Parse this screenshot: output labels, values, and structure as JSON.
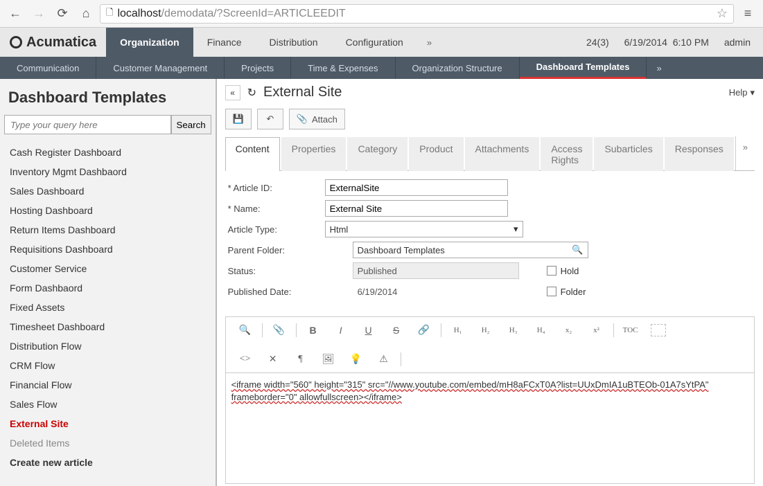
{
  "browser": {
    "url_host": "localhost",
    "url_path": "/demodata/?ScreenId=ARTICLEEDIT"
  },
  "brand": "Acumatica",
  "top_tabs": [
    "Organization",
    "Finance",
    "Distribution",
    "Configuration"
  ],
  "top_right": {
    "count": "24(3)",
    "date": "6/19/2014",
    "time": "6:10 PM",
    "user": "admin"
  },
  "sub_nav": [
    "Communication",
    "Customer Management",
    "Projects",
    "Time & Expenses",
    "Organization Structure",
    "Dashboard Templates"
  ],
  "sidebar": {
    "title": "Dashboard Templates",
    "search_placeholder": "Type your query here",
    "search_btn": "Search",
    "items": [
      "Cash Register Dashboard",
      "Inventory Mgmt Dashbaord",
      "Sales Dashboard",
      "Hosting Dashboard",
      "Return Items Dashboard",
      "Requisitions Dashboard",
      "Customer Service",
      "Form Dashbaord",
      "Fixed Assets",
      "Timesheet Dashboard",
      "Distribution Flow",
      "CRM Flow",
      "Financial Flow",
      "Sales Flow",
      "External Site",
      "Deleted Items",
      "Create new article"
    ]
  },
  "content": {
    "title": "External Site",
    "help": "Help",
    "attach": "Attach",
    "tabs": [
      "Content",
      "Properties",
      "Category",
      "Product",
      "Attachments",
      "Access Rights",
      "Subarticles",
      "Responses"
    ],
    "form": {
      "article_id_label": "Article ID:",
      "article_id": "ExternalSite",
      "name_label": "Name:",
      "name": "External Site",
      "type_label": "Article Type:",
      "type": "Html",
      "parent_label": "Parent Folder:",
      "parent": "Dashboard Templates",
      "status_label": "Status:",
      "status": "Published",
      "hold_label": "Hold",
      "pubdate_label": "Published Date:",
      "pubdate": "6/19/2014",
      "folder_label": "Folder"
    },
    "editor_text": "<iframe width=\"560\" height=\"315\" src=\"//www.youtube.com/embed/mH8aFCxT0A?list=UUxDmIA1uBTEOb-01A7sYtPA\" frameborder=\"0\" allowfullscreen></iframe>",
    "editor_labels": {
      "h1": "H₁",
      "h2": "H₂",
      "h3": "H₃",
      "h4": "H₄",
      "sub": "x₂",
      "sup": "x²",
      "toc": "TOC"
    }
  }
}
